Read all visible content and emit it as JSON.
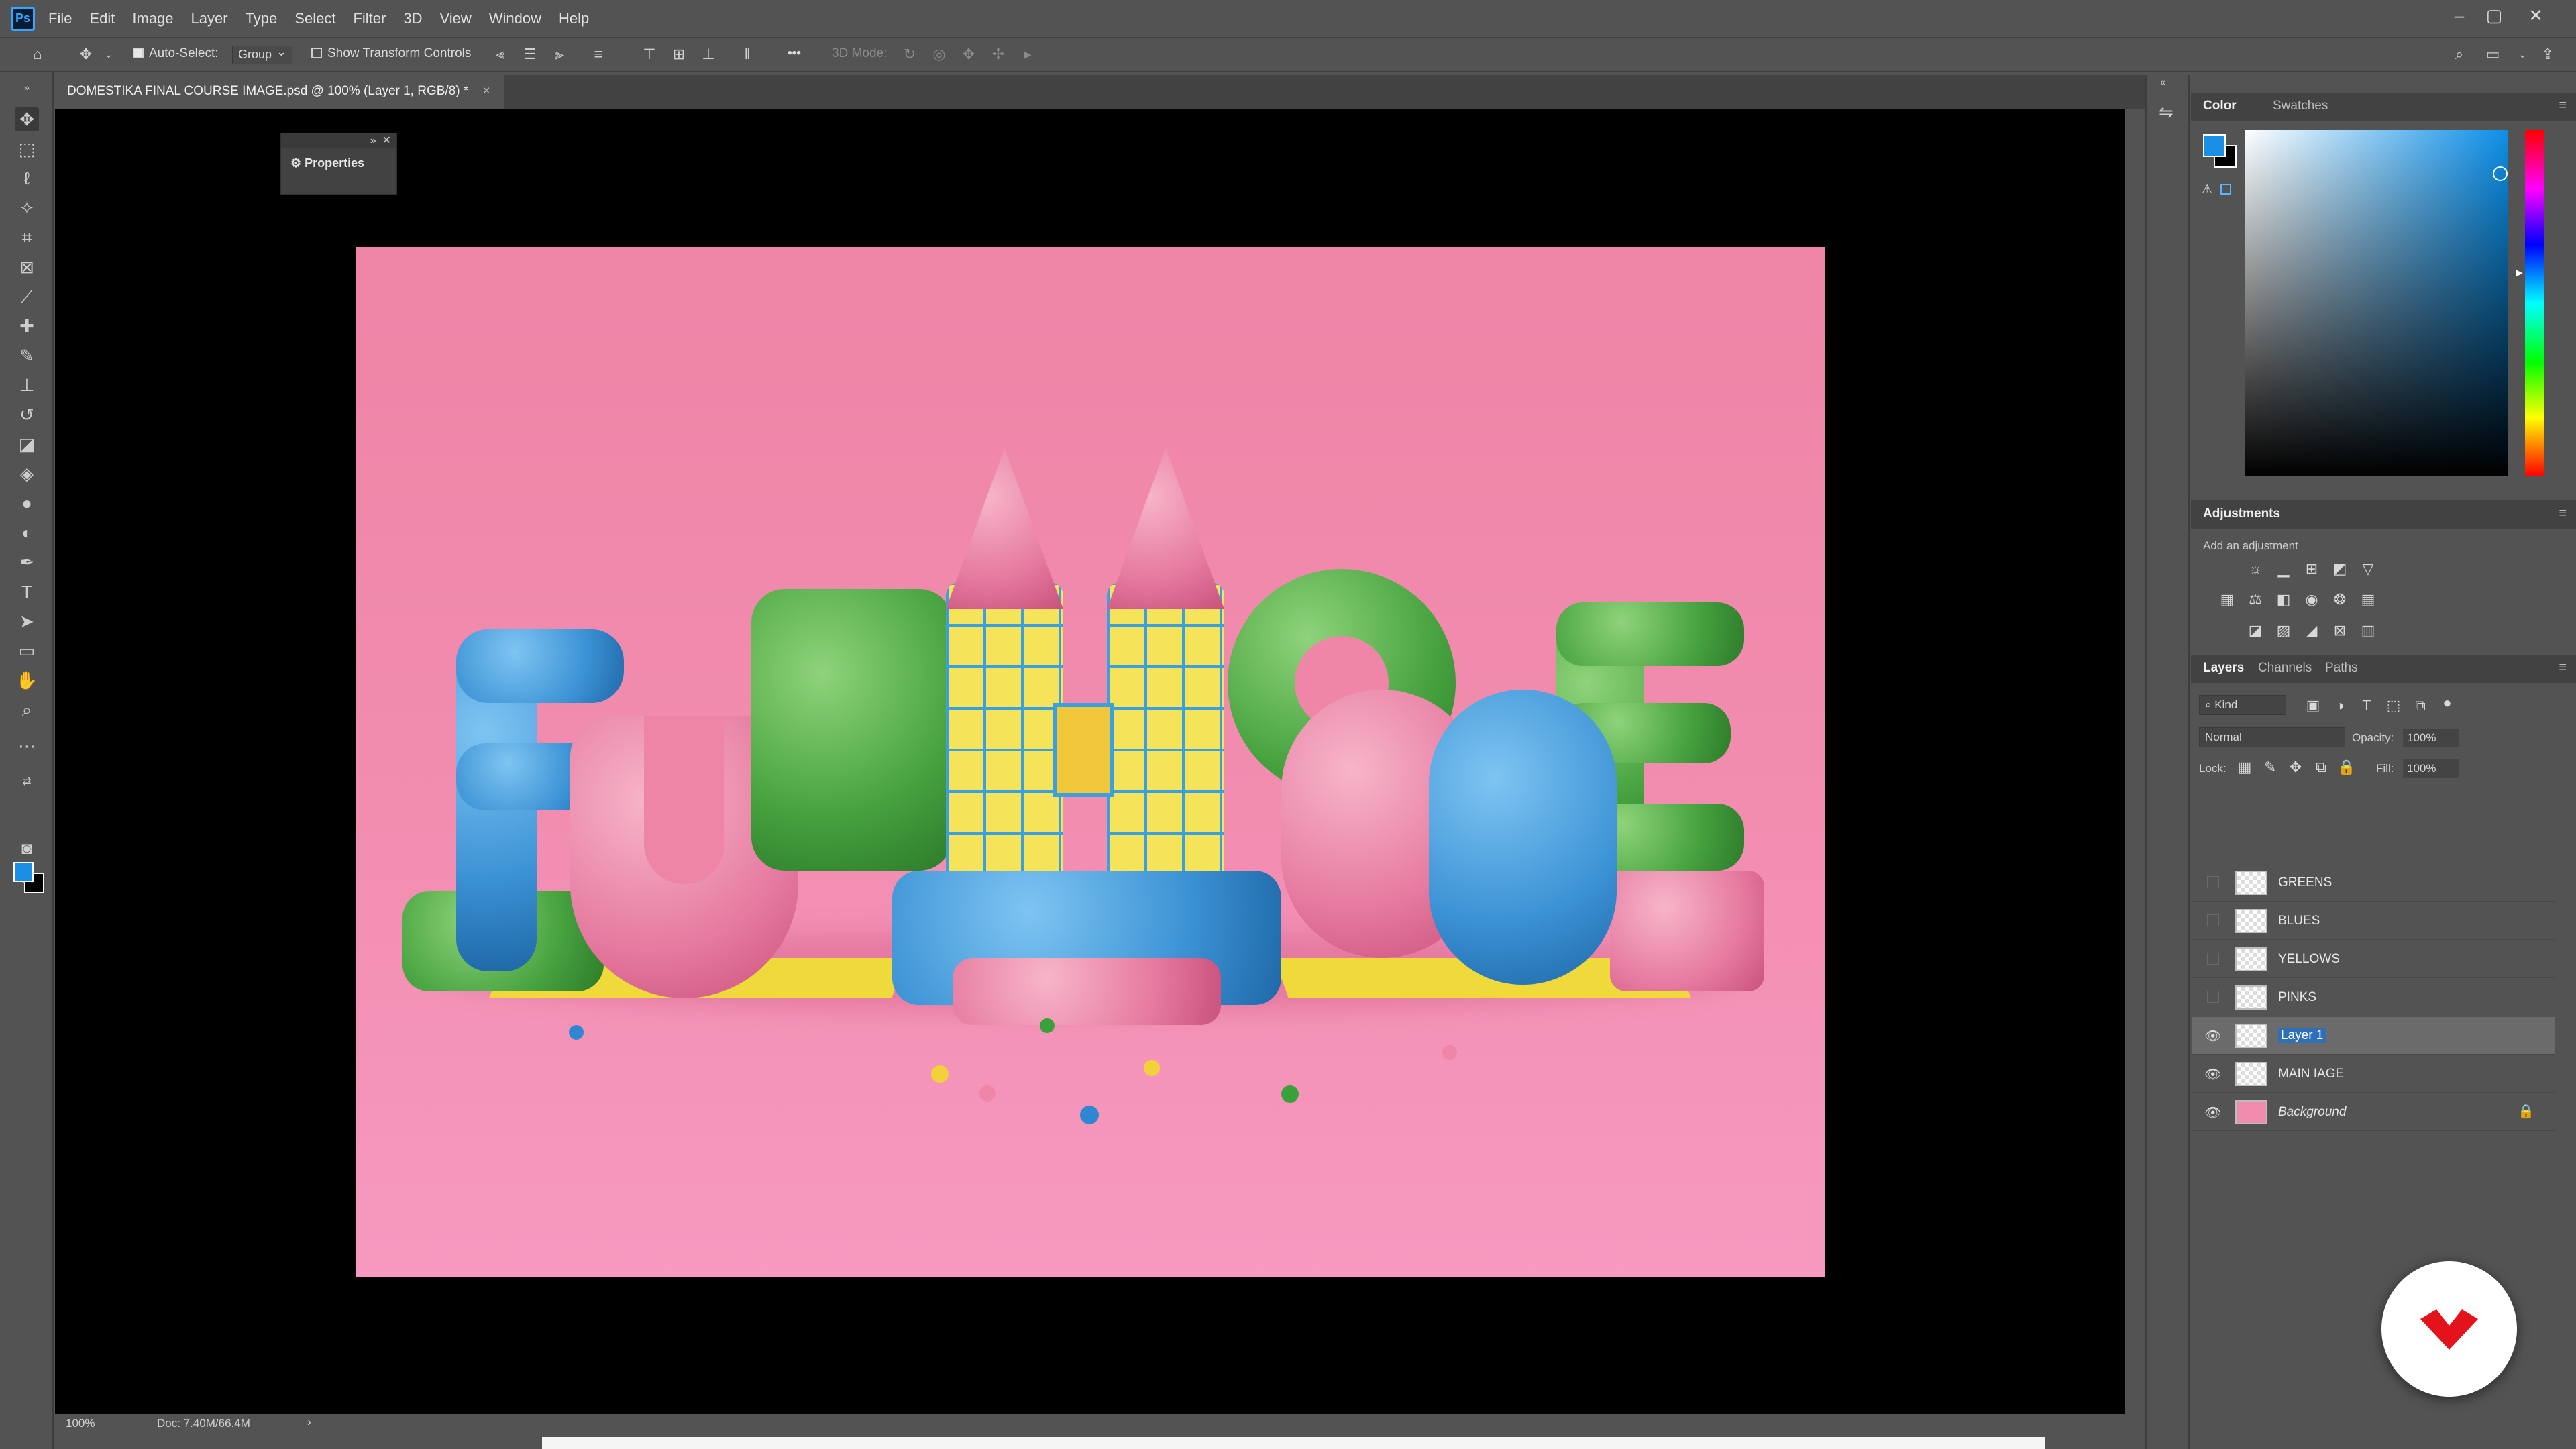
{
  "app": {
    "logo": "Ps",
    "menu": [
      "File",
      "Edit",
      "Image",
      "Layer",
      "Type",
      "Select",
      "Filter",
      "3D",
      "View",
      "Window",
      "Help"
    ],
    "window_controls": [
      "–",
      "▢",
      "✕"
    ]
  },
  "options_bar": {
    "auto_select_label": "Auto-Select:",
    "auto_select_value": "Group",
    "show_transform_label": "Show Transform Controls",
    "three_d_mode_label": "3D Mode:",
    "more_label": "•••"
  },
  "document": {
    "tab_title": "DOMESTIKA FINAL COURSE IMAGE.psd @ 100% (Layer 1, RGB/8) *",
    "close": "×"
  },
  "properties_panel": {
    "label": "Properties",
    "collapse": "»",
    "close": "✕"
  },
  "status": {
    "zoom": "100%",
    "doc_size": "Doc: 7.40M/66.4M",
    "arrow": "›"
  },
  "color_panel": {
    "tabs": [
      "Color",
      "Swatches"
    ],
    "foreground": "#1b8fe3",
    "background": "#000000"
  },
  "adjustments_panel": {
    "title": "Adjustments",
    "subtitle": "Add an adjustment"
  },
  "layers_panel": {
    "tabs": [
      "Layers",
      "Channels",
      "Paths"
    ],
    "filter_kind": "Kind",
    "blend_mode": "Normal",
    "opacity_label": "Opacity:",
    "opacity_value": "100%",
    "lock_label": "Lock:",
    "fill_label": "Fill:",
    "fill_value": "100%",
    "layers": [
      {
        "name": "GREENS",
        "visible": false,
        "selected": false,
        "italic": false
      },
      {
        "name": "BLUES",
        "visible": false,
        "selected": false,
        "italic": false
      },
      {
        "name": "YELLOWS",
        "visible": false,
        "selected": false,
        "italic": false
      },
      {
        "name": "PINKS",
        "visible": false,
        "selected": false,
        "italic": false
      },
      {
        "name": "Layer 1",
        "visible": true,
        "selected": true,
        "italic": false
      },
      {
        "name": "MAIN IAGE",
        "visible": true,
        "selected": false,
        "italic": false
      },
      {
        "name": "Background",
        "visible": true,
        "selected": false,
        "italic": true,
        "locked": true
      }
    ]
  },
  "colors": {
    "accent": "#31a8ff",
    "canvas_pink": "#f08cae",
    "domestika_red": "#e3121b"
  }
}
